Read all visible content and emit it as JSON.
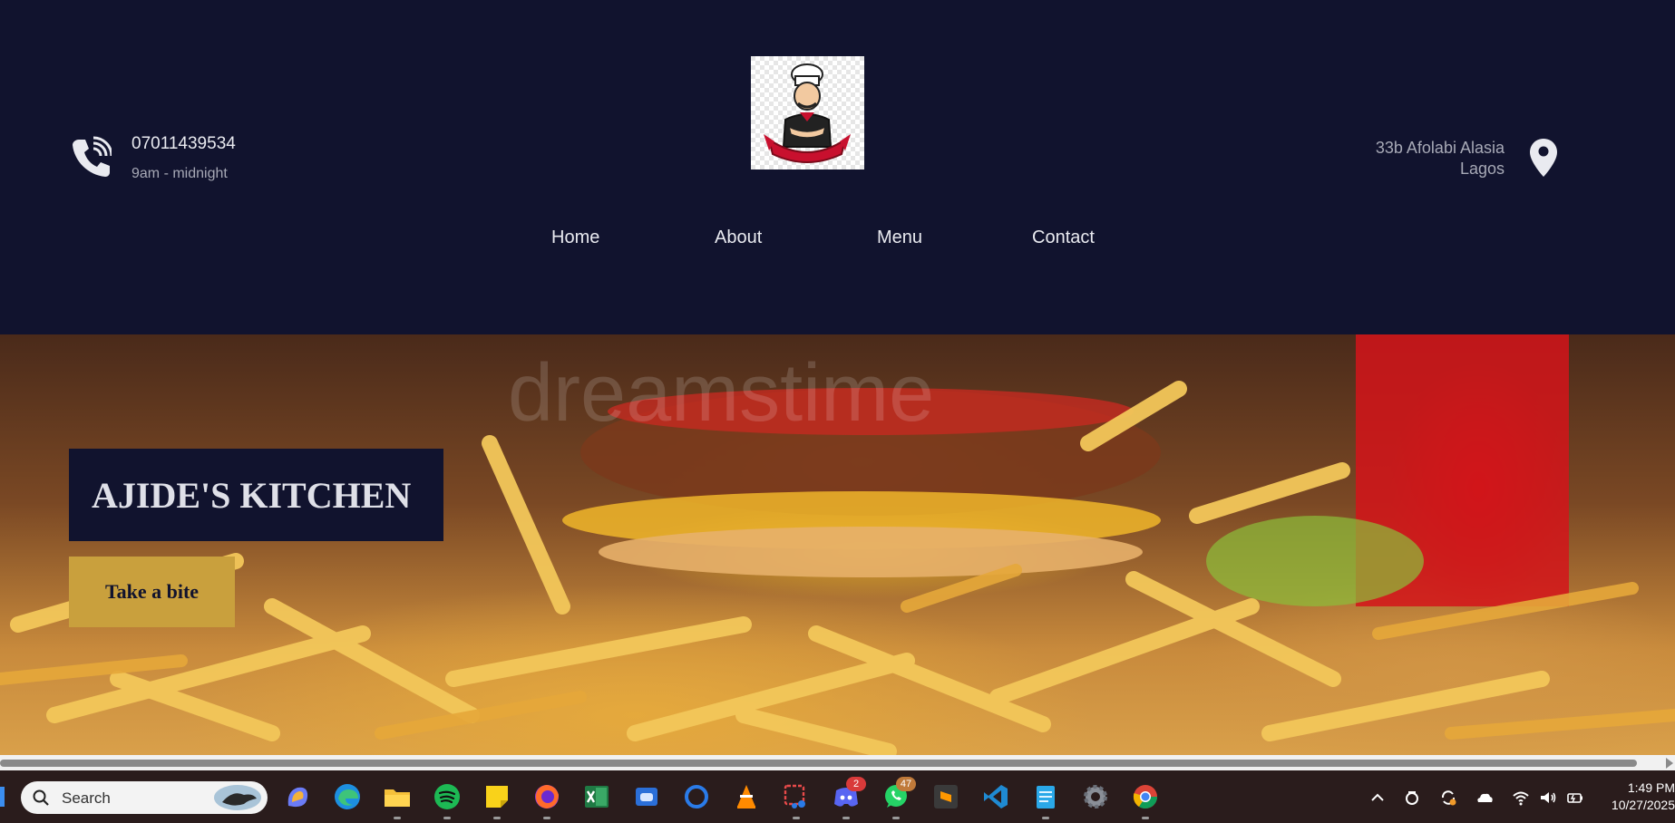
{
  "header": {
    "phone_number": "07011439534",
    "hours": "9am - midnight",
    "address_line1": "33b Afolabi Alasia",
    "address_line2": "Lagos",
    "icons": {
      "phone": "phone-icon",
      "location": "location-pin-icon",
      "logo": "chef-logo"
    }
  },
  "nav": {
    "items": [
      {
        "label": "Home"
      },
      {
        "label": "About"
      },
      {
        "label": "Menu"
      },
      {
        "label": "Contact"
      }
    ]
  },
  "hero": {
    "title": "AJIDE'S KITCHEN",
    "cta_label": "Take a bite",
    "watermark": "dreamstime"
  },
  "taskbar": {
    "search_placeholder": "Search",
    "apps": [
      {
        "name": "copilot-icon"
      },
      {
        "name": "edge-icon"
      },
      {
        "name": "file-explorer-icon"
      },
      {
        "name": "spotify-icon"
      },
      {
        "name": "sticky-notes-icon"
      },
      {
        "name": "firefox-icon"
      },
      {
        "name": "excel-icon"
      },
      {
        "name": "game-bar-icon"
      },
      {
        "name": "cortana-icon"
      },
      {
        "name": "vlc-icon"
      },
      {
        "name": "snipping-tool-icon"
      },
      {
        "name": "discord-icon",
        "badge": "2"
      },
      {
        "name": "whatsapp-icon",
        "badge": "47"
      },
      {
        "name": "sublime-text-icon"
      },
      {
        "name": "vscode-icon"
      },
      {
        "name": "notepad-icon"
      },
      {
        "name": "settings-icon"
      },
      {
        "name": "chrome-icon"
      }
    ],
    "time": "1:49 PM",
    "date": "10/27/2025"
  },
  "colors": {
    "header_bg": "#11132e",
    "accent_gold": "#c9a03d",
    "nav_text": "#e9eaf0"
  }
}
